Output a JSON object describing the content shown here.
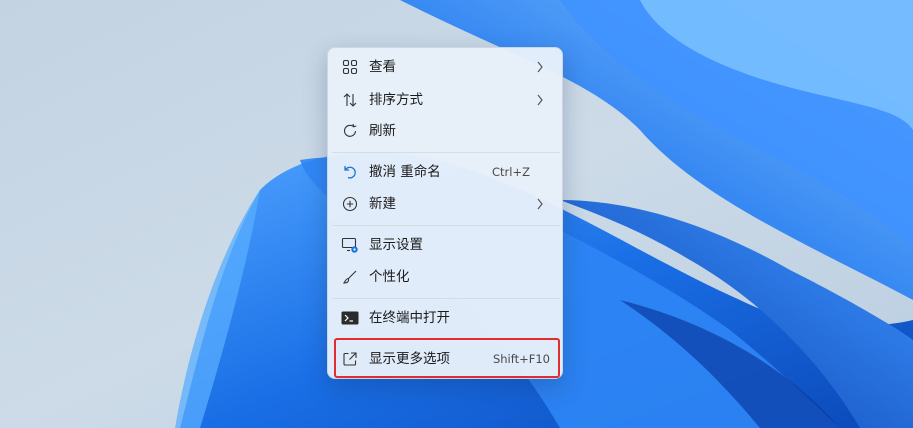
{
  "menu": {
    "items": [
      {
        "label": "查看",
        "icon": "view-grid-icon",
        "has_submenu": true
      },
      {
        "label": "排序方式",
        "icon": "sort-icon",
        "has_submenu": true
      },
      {
        "label": "刷新",
        "icon": "refresh-icon",
        "has_submenu": false
      },
      {
        "label": "撤消 重命名",
        "icon": "undo-icon",
        "shortcut": "Ctrl+Z"
      },
      {
        "label": "新建",
        "icon": "new-plus-icon",
        "has_submenu": true
      },
      {
        "label": "显示设置",
        "icon": "display-settings-icon"
      },
      {
        "label": "个性化",
        "icon": "brush-icon"
      },
      {
        "label": "在终端中打开",
        "icon": "terminal-icon"
      },
      {
        "label": "显示更多选项",
        "icon": "show-more-icon",
        "shortcut": "Shift+F10",
        "highlighted": true
      }
    ]
  },
  "colors": {
    "menu_background": "#e8f0fa",
    "highlight_border": "#e02d2d",
    "wallpaper_blue": "#1a6fe6"
  }
}
